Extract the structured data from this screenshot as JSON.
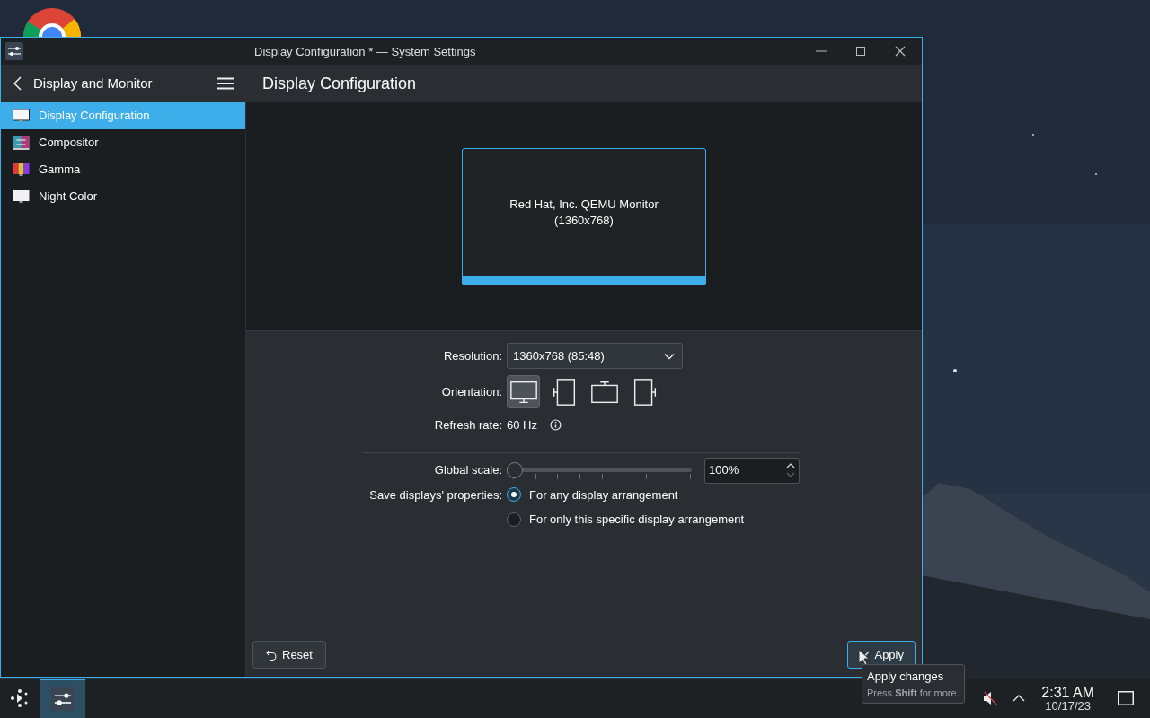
{
  "window": {
    "title": "Display Configuration * — System Settings"
  },
  "sidebar": {
    "title": "Display and Monitor",
    "items": [
      {
        "label": "Display Configuration",
        "kind": "display",
        "selected": true
      },
      {
        "label": "Compositor",
        "kind": "compositor",
        "selected": false
      },
      {
        "label": "Gamma",
        "kind": "gamma",
        "selected": false
      },
      {
        "label": "Night Color",
        "kind": "night",
        "selected": false
      }
    ]
  },
  "page": {
    "title": "Display Configuration"
  },
  "monitor": {
    "name": "Red Hat, Inc. QEMU Monitor",
    "resolution": "(1360x768)",
    "selected": true
  },
  "resolution": {
    "label": "Resolution:",
    "value": "1360x768 (85:48)"
  },
  "orientation": {
    "label": "Orientation:",
    "options": [
      {
        "kind": "normal",
        "selected": true
      },
      {
        "kind": "left",
        "selected": false
      },
      {
        "kind": "inverted",
        "selected": false
      },
      {
        "kind": "right",
        "selected": false
      }
    ]
  },
  "refresh": {
    "label": "Refresh rate:",
    "value": "60 Hz"
  },
  "scale": {
    "label": "Global scale:",
    "level": 0,
    "value": "100%"
  },
  "save_properties": {
    "label": "Save displays' properties:",
    "options": [
      {
        "label": "For any display arrangement",
        "selected": true
      },
      {
        "label": "For only this specific display arrangement",
        "selected": false
      }
    ]
  },
  "buttons": {
    "reset": "Reset",
    "apply": "Apply"
  },
  "tooltip": {
    "title": "Apply changes",
    "text": "Press **Shift** for more."
  },
  "tray": {
    "muted": true,
    "time": "2:31 AM",
    "date": "10/17/23"
  }
}
